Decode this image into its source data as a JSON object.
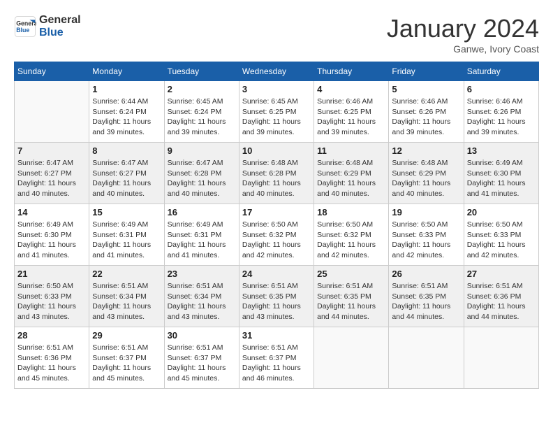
{
  "header": {
    "logo": {
      "line1": "General",
      "line2": "Blue"
    },
    "title": "January 2024",
    "location": "Ganwe, Ivory Coast"
  },
  "days_of_week": [
    "Sunday",
    "Monday",
    "Tuesday",
    "Wednesday",
    "Thursday",
    "Friday",
    "Saturday"
  ],
  "weeks": [
    {
      "shaded": false,
      "days": [
        {
          "empty": true
        },
        {
          "number": "1",
          "sunrise": "6:44 AM",
          "sunset": "6:24 PM",
          "daylight": "11 hours and 39 minutes."
        },
        {
          "number": "2",
          "sunrise": "6:45 AM",
          "sunset": "6:24 PM",
          "daylight": "11 hours and 39 minutes."
        },
        {
          "number": "3",
          "sunrise": "6:45 AM",
          "sunset": "6:25 PM",
          "daylight": "11 hours and 39 minutes."
        },
        {
          "number": "4",
          "sunrise": "6:46 AM",
          "sunset": "6:25 PM",
          "daylight": "11 hours and 39 minutes."
        },
        {
          "number": "5",
          "sunrise": "6:46 AM",
          "sunset": "6:26 PM",
          "daylight": "11 hours and 39 minutes."
        },
        {
          "number": "6",
          "sunrise": "6:46 AM",
          "sunset": "6:26 PM",
          "daylight": "11 hours and 39 minutes."
        }
      ]
    },
    {
      "shaded": true,
      "days": [
        {
          "number": "7",
          "sunrise": "6:47 AM",
          "sunset": "6:27 PM",
          "daylight": "11 hours and 40 minutes."
        },
        {
          "number": "8",
          "sunrise": "6:47 AM",
          "sunset": "6:27 PM",
          "daylight": "11 hours and 40 minutes."
        },
        {
          "number": "9",
          "sunrise": "6:47 AM",
          "sunset": "6:28 PM",
          "daylight": "11 hours and 40 minutes."
        },
        {
          "number": "10",
          "sunrise": "6:48 AM",
          "sunset": "6:28 PM",
          "daylight": "11 hours and 40 minutes."
        },
        {
          "number": "11",
          "sunrise": "6:48 AM",
          "sunset": "6:29 PM",
          "daylight": "11 hours and 40 minutes."
        },
        {
          "number": "12",
          "sunrise": "6:48 AM",
          "sunset": "6:29 PM",
          "daylight": "11 hours and 40 minutes."
        },
        {
          "number": "13",
          "sunrise": "6:49 AM",
          "sunset": "6:30 PM",
          "daylight": "11 hours and 41 minutes."
        }
      ]
    },
    {
      "shaded": false,
      "days": [
        {
          "number": "14",
          "sunrise": "6:49 AM",
          "sunset": "6:30 PM",
          "daylight": "11 hours and 41 minutes."
        },
        {
          "number": "15",
          "sunrise": "6:49 AM",
          "sunset": "6:31 PM",
          "daylight": "11 hours and 41 minutes."
        },
        {
          "number": "16",
          "sunrise": "6:49 AM",
          "sunset": "6:31 PM",
          "daylight": "11 hours and 41 minutes."
        },
        {
          "number": "17",
          "sunrise": "6:50 AM",
          "sunset": "6:32 PM",
          "daylight": "11 hours and 42 minutes."
        },
        {
          "number": "18",
          "sunrise": "6:50 AM",
          "sunset": "6:32 PM",
          "daylight": "11 hours and 42 minutes."
        },
        {
          "number": "19",
          "sunrise": "6:50 AM",
          "sunset": "6:33 PM",
          "daylight": "11 hours and 42 minutes."
        },
        {
          "number": "20",
          "sunrise": "6:50 AM",
          "sunset": "6:33 PM",
          "daylight": "11 hours and 42 minutes."
        }
      ]
    },
    {
      "shaded": true,
      "days": [
        {
          "number": "21",
          "sunrise": "6:50 AM",
          "sunset": "6:33 PM",
          "daylight": "11 hours and 43 minutes."
        },
        {
          "number": "22",
          "sunrise": "6:51 AM",
          "sunset": "6:34 PM",
          "daylight": "11 hours and 43 minutes."
        },
        {
          "number": "23",
          "sunrise": "6:51 AM",
          "sunset": "6:34 PM",
          "daylight": "11 hours and 43 minutes."
        },
        {
          "number": "24",
          "sunrise": "6:51 AM",
          "sunset": "6:35 PM",
          "daylight": "11 hours and 43 minutes."
        },
        {
          "number": "25",
          "sunrise": "6:51 AM",
          "sunset": "6:35 PM",
          "daylight": "11 hours and 44 minutes."
        },
        {
          "number": "26",
          "sunrise": "6:51 AM",
          "sunset": "6:35 PM",
          "daylight": "11 hours and 44 minutes."
        },
        {
          "number": "27",
          "sunrise": "6:51 AM",
          "sunset": "6:36 PM",
          "daylight": "11 hours and 44 minutes."
        }
      ]
    },
    {
      "shaded": false,
      "days": [
        {
          "number": "28",
          "sunrise": "6:51 AM",
          "sunset": "6:36 PM",
          "daylight": "11 hours and 45 minutes."
        },
        {
          "number": "29",
          "sunrise": "6:51 AM",
          "sunset": "6:37 PM",
          "daylight": "11 hours and 45 minutes."
        },
        {
          "number": "30",
          "sunrise": "6:51 AM",
          "sunset": "6:37 PM",
          "daylight": "11 hours and 45 minutes."
        },
        {
          "number": "31",
          "sunrise": "6:51 AM",
          "sunset": "6:37 PM",
          "daylight": "11 hours and 46 minutes."
        },
        {
          "empty": true
        },
        {
          "empty": true
        },
        {
          "empty": true
        }
      ]
    }
  ],
  "labels": {
    "sunrise": "Sunrise:",
    "sunset": "Sunset:",
    "daylight": "Daylight:"
  }
}
